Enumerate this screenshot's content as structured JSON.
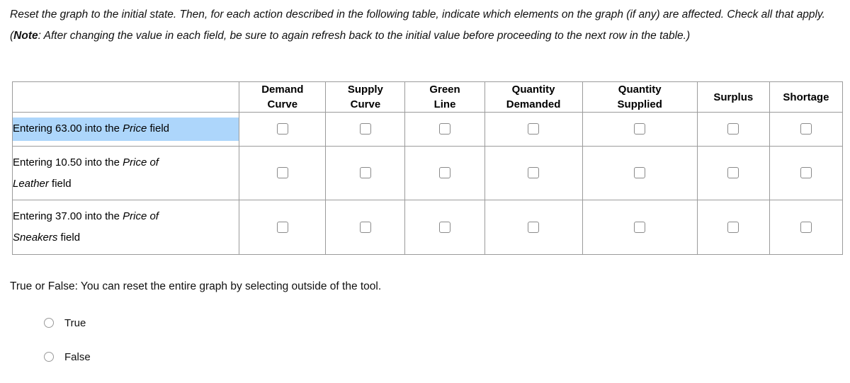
{
  "intro": {
    "line1": "Reset the graph to the initial state. Then, for each action described in the following table, indicate which elements on the graph (if any) are affected.",
    "line2_before_note": "Check all that apply. (",
    "note_label": "Note",
    "line2_after_note": ": After changing the value in each field, be sure to again refresh back to the initial value before proceeding to the next row in the table.)"
  },
  "table": {
    "blank_header": "",
    "headers": [
      {
        "top": "Demand",
        "bottom": "Curve"
      },
      {
        "top": "Supply",
        "bottom": "Curve"
      },
      {
        "top": "Green",
        "bottom": "Line"
      },
      {
        "top": "Quantity",
        "bottom": "Demanded"
      },
      {
        "top": "Quantity",
        "bottom": "Supplied"
      },
      {
        "top": "",
        "bottom": "Surplus"
      },
      {
        "top": "",
        "bottom": "Shortage"
      }
    ],
    "rows": [
      {
        "highlighted": true,
        "line1_plain_a": "Entering 63.00 into the ",
        "line1_italic": "Price",
        "line1_plain_b": " field",
        "line2_italic": "",
        "line2_plain": "",
        "checkboxes": [
          false,
          false,
          false,
          false,
          false,
          false,
          false
        ]
      },
      {
        "highlighted": false,
        "line1_plain_a": "Entering 10.50 into the ",
        "line1_italic": "Price of",
        "line1_plain_b": "",
        "line2_italic": "Leather",
        "line2_plain": " field",
        "checkboxes": [
          false,
          false,
          false,
          false,
          false,
          false,
          false
        ]
      },
      {
        "highlighted": false,
        "line1_plain_a": "Entering 37.00 into the ",
        "line1_italic": "Price of",
        "line1_plain_b": "",
        "line2_italic": "Sneakers",
        "line2_plain": " field",
        "checkboxes": [
          false,
          false,
          false,
          false,
          false,
          false,
          false
        ]
      }
    ]
  },
  "true_false": {
    "question": "True or False: You can reset the entire graph by selecting outside of the tool.",
    "options": [
      {
        "label": "True",
        "selected": false
      },
      {
        "label": "False",
        "selected": false
      }
    ]
  },
  "colors": {
    "selection_highlight": "#add6fb",
    "table_border": "#9b9b9b",
    "control_border": "#8a8a8a",
    "text": "#111111"
  }
}
